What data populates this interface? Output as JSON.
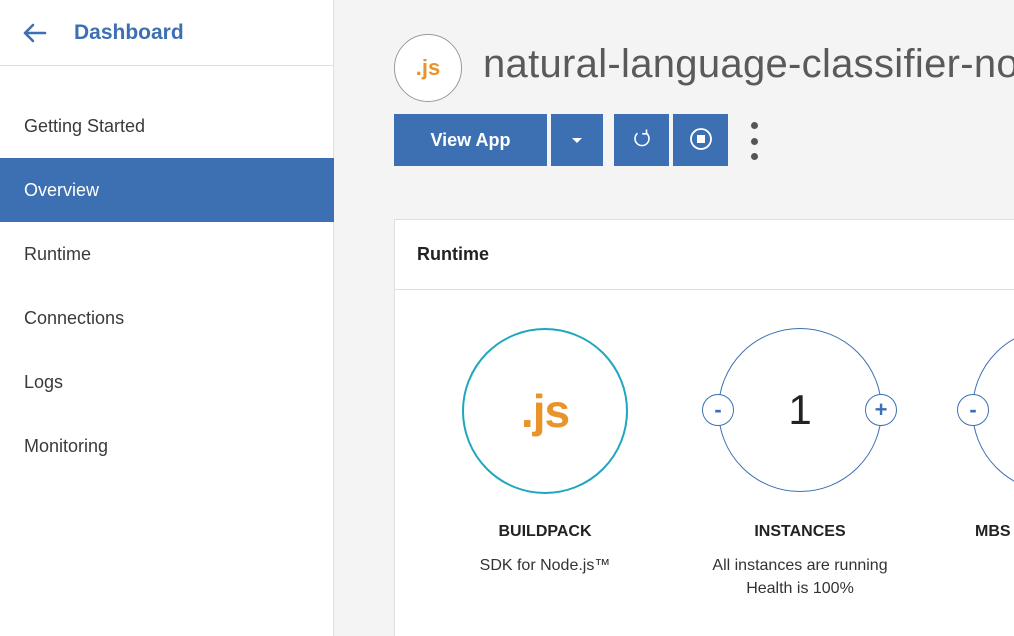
{
  "sidebar": {
    "title": "Dashboard",
    "back_icon": "arrow-left-icon",
    "items": [
      {
        "label": "Getting Started",
        "active": false
      },
      {
        "label": "Overview",
        "active": true
      },
      {
        "label": "Runtime",
        "active": false
      },
      {
        "label": "Connections",
        "active": false
      },
      {
        "label": "Logs",
        "active": false
      },
      {
        "label": "Monitoring",
        "active": false
      }
    ]
  },
  "app": {
    "logo_text": ".js",
    "name": "natural-language-classifier-no"
  },
  "toolbar": {
    "view_app_label": "View App",
    "caret_icon": "caret-down-icon",
    "restart_icon": "restart-icon",
    "stop_icon": "stop-icon",
    "more_icon": "more-vertical-icon"
  },
  "runtime": {
    "title": "Runtime",
    "buildpack": {
      "logo_text": ".js",
      "label": "BUILDPACK",
      "value": "SDK for Node.js™"
    },
    "instances": {
      "count": "1",
      "minus": "-",
      "plus": "+",
      "label": "INSTANCES",
      "status_line1": "All instances are running",
      "status_line2": "Health is 100%"
    },
    "memory": {
      "minus": "-",
      "label": "MBS"
    }
  },
  "colors": {
    "accent": "#3d70b2",
    "buildpack_ring": "#1fa6bf",
    "js_orange": "#e8942a"
  }
}
